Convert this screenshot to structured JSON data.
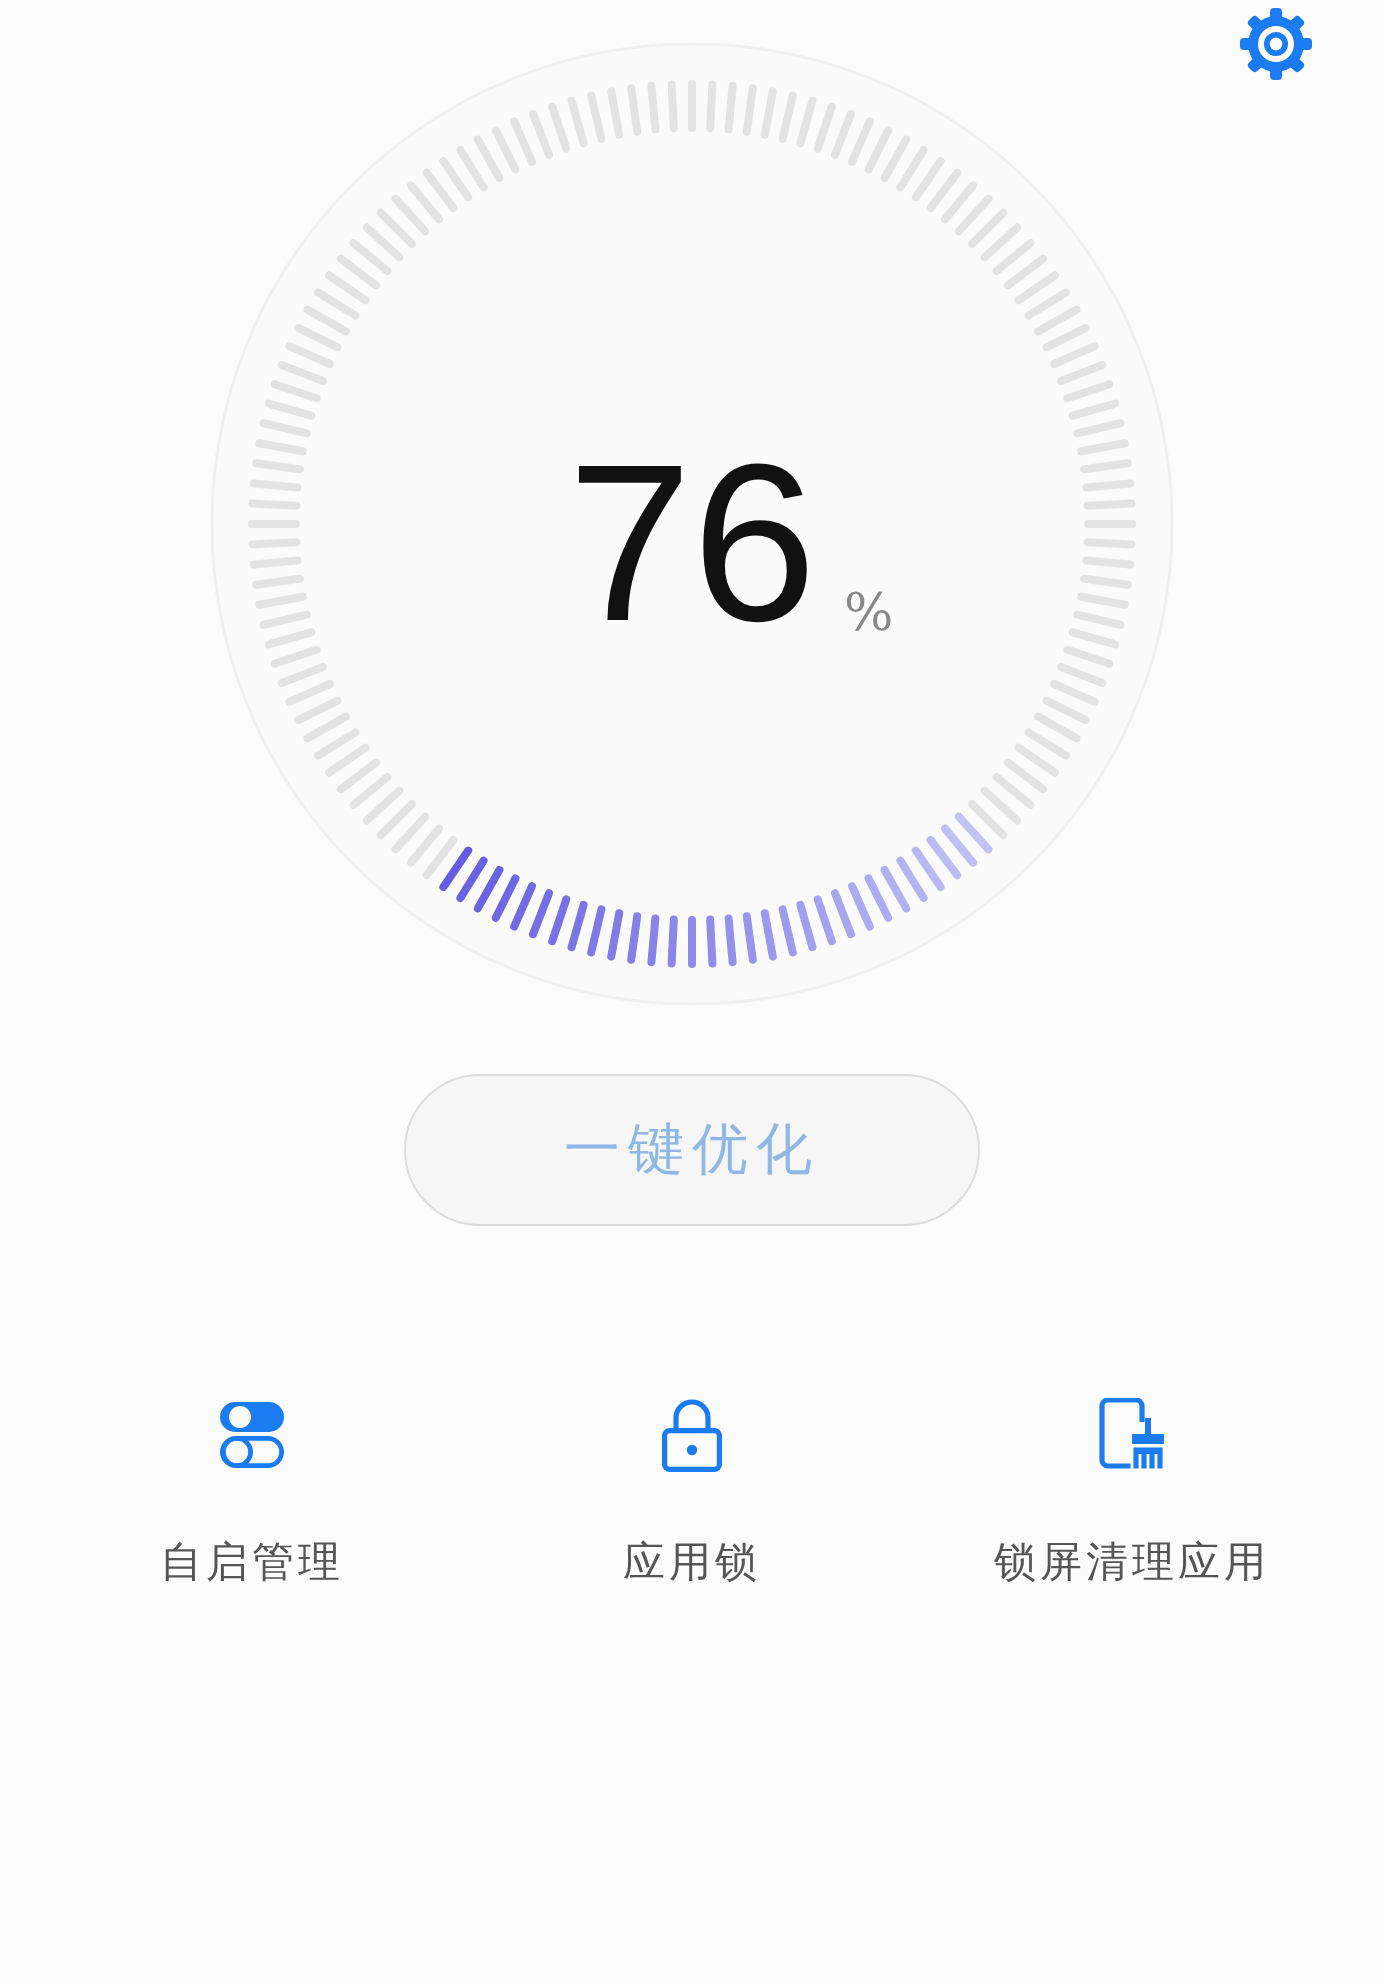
{
  "score": {
    "value": "76",
    "unit": "%"
  },
  "optimize_button": {
    "label": "一键优化",
    "disabled": true
  },
  "shortcuts": [
    {
      "kind": "toggles",
      "label": "自启管理"
    },
    {
      "kind": "lock",
      "label": "应用锁"
    },
    {
      "kind": "phone-clean",
      "label": "锁屏清理应用"
    }
  ]
}
